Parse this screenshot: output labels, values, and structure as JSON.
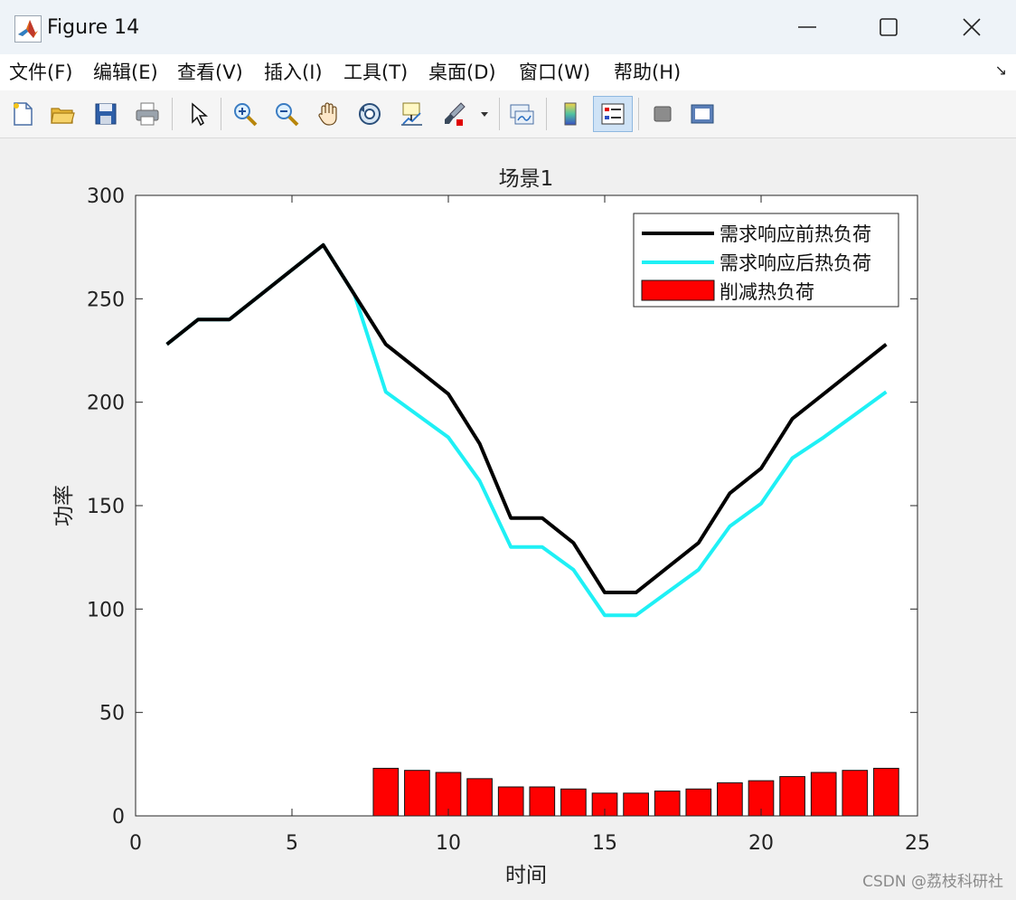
{
  "window": {
    "title": "Figure 14",
    "icons": [
      "matlab-logo-icon",
      "minimize-icon",
      "maximize-icon",
      "close-icon"
    ]
  },
  "menu": {
    "items": [
      "文件(F)",
      "编辑(E)",
      "查看(V)",
      "插入(I)",
      "工具(T)",
      "桌面(D)",
      "窗口(W)",
      "帮助(H)"
    ],
    "corner_glyph": "↘"
  },
  "toolbar": {
    "buttons": [
      {
        "icon": "new-figure-icon"
      },
      {
        "icon": "open-file-icon"
      },
      {
        "icon": "save-icon"
      },
      {
        "icon": "print-icon"
      },
      {
        "icon": "pointer-icon"
      },
      {
        "icon": "zoom-in-icon"
      },
      {
        "icon": "zoom-out-icon"
      },
      {
        "icon": "pan-icon"
      },
      {
        "icon": "rotate-3d-icon"
      },
      {
        "icon": "data-cursor-icon"
      },
      {
        "icon": "brush-icon"
      },
      {
        "icon": "link-plot-icon"
      },
      {
        "icon": "colorbar-icon"
      },
      {
        "icon": "legend-icon",
        "active": true
      },
      {
        "icon": "hide-plot-tools-icon"
      },
      {
        "icon": "show-plot-tools-icon"
      }
    ]
  },
  "colors": {
    "before_line": "#000000",
    "after_line": "#1ff0f5",
    "bar": "#ff0000"
  },
  "chart_data": {
    "type": "line",
    "title": "场景1",
    "xlabel": "时间",
    "ylabel": "功率",
    "xlim": [
      0,
      25
    ],
    "ylim": [
      0,
      300
    ],
    "xticks": [
      0,
      5,
      10,
      15,
      20,
      25
    ],
    "yticks": [
      0,
      50,
      100,
      150,
      200,
      250,
      300
    ],
    "grid": false,
    "legend_position": "top-right",
    "series": [
      {
        "name": "需求响应前热负荷",
        "type": "line",
        "x": [
          1,
          2,
          3,
          4,
          5,
          6,
          7,
          8,
          9,
          10,
          11,
          12,
          13,
          14,
          15,
          16,
          17,
          18,
          19,
          20,
          21,
          22,
          23,
          24
        ],
        "values": [
          228,
          240,
          240,
          252,
          264,
          276,
          252,
          228,
          216,
          204,
          180,
          144,
          144,
          132,
          108,
          108,
          120,
          132,
          156,
          168,
          192,
          204,
          216,
          228
        ]
      },
      {
        "name": "需求响应后热负荷",
        "type": "line",
        "x": [
          1,
          2,
          3,
          4,
          5,
          6,
          7,
          8,
          9,
          10,
          11,
          12,
          13,
          14,
          15,
          16,
          17,
          18,
          19,
          20,
          21,
          22,
          23,
          24
        ],
        "values": [
          228,
          240,
          240,
          252,
          264,
          276,
          252,
          205,
          194,
          183,
          162,
          130,
          130,
          119,
          97,
          97,
          108,
          119,
          140,
          151,
          173,
          183,
          194,
          205
        ]
      },
      {
        "name": "削减热负荷",
        "type": "bar",
        "x": [
          8,
          9,
          10,
          11,
          12,
          13,
          14,
          15,
          16,
          17,
          18,
          19,
          20,
          21,
          22,
          23,
          24
        ],
        "values": [
          23,
          22,
          21,
          18,
          14,
          14,
          13,
          11,
          11,
          12,
          13,
          16,
          17,
          19,
          21,
          22,
          23
        ]
      }
    ]
  },
  "watermark": "CSDN @荔枝科研社"
}
